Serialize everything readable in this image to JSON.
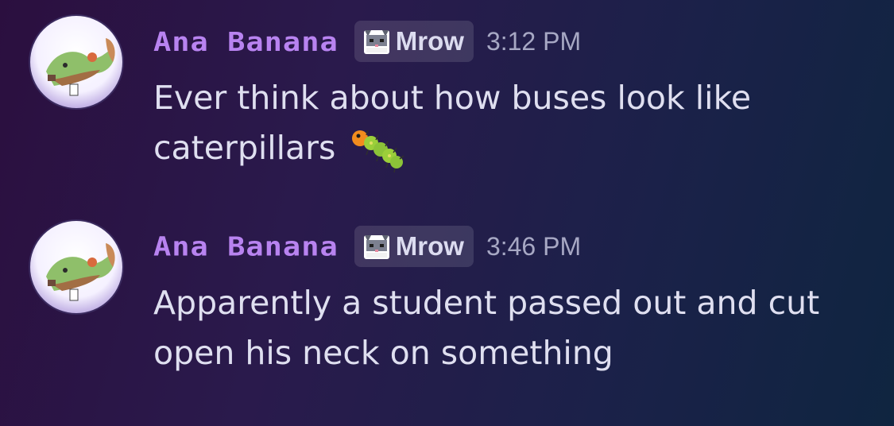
{
  "messages": [
    {
      "author": "Ana Banana",
      "tag": {
        "label": "Mrow",
        "icon": "cat-face-icon"
      },
      "time": "3:12 PM",
      "lines": [
        "Ever think about how buses look like",
        "caterpillars"
      ],
      "emoji": "caterpillar-emoji"
    },
    {
      "author": "Ana Banana",
      "tag": {
        "label": "Mrow",
        "icon": "cat-face-icon"
      },
      "time": "3:46 PM",
      "lines": [
        "Apparently a student passed out and cut",
        "open his neck on something"
      ]
    }
  ],
  "colors": {
    "username": "#b883f0",
    "message_text": "#dfdff0",
    "timestamp": "#a7a8c4",
    "tag_background": "#3a3560"
  }
}
